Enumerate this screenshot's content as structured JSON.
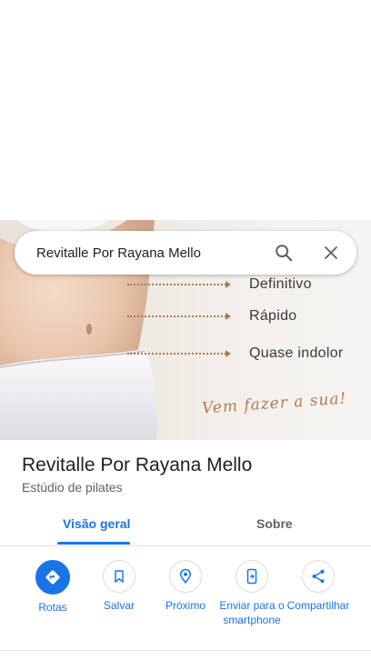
{
  "search": {
    "query": "Revitalle Por Rayana Mello"
  },
  "hero": {
    "features": [
      "Definitivo",
      "Rápido",
      "Quase indolor"
    ],
    "tagline": "Vem fazer a sua!"
  },
  "place": {
    "name": "Revitalle Por Rayana Mello",
    "category": "Estúdio de pilates"
  },
  "tabs": [
    {
      "label": "Visão geral",
      "active": true
    },
    {
      "label": "Sobre",
      "active": false
    }
  ],
  "actions": [
    {
      "label": "Rotas",
      "icon": "directions-icon"
    },
    {
      "label": "Salvar",
      "icon": "bookmark-icon"
    },
    {
      "label": "Próximo",
      "icon": "nearby-icon"
    },
    {
      "label": "Enviar para o smartphone",
      "icon": "send-to-phone-icon"
    },
    {
      "label": "Compartilhar",
      "icon": "share-icon"
    }
  ],
  "colors": {
    "accent": "#1a73e8",
    "tagline": "#b07b56"
  }
}
